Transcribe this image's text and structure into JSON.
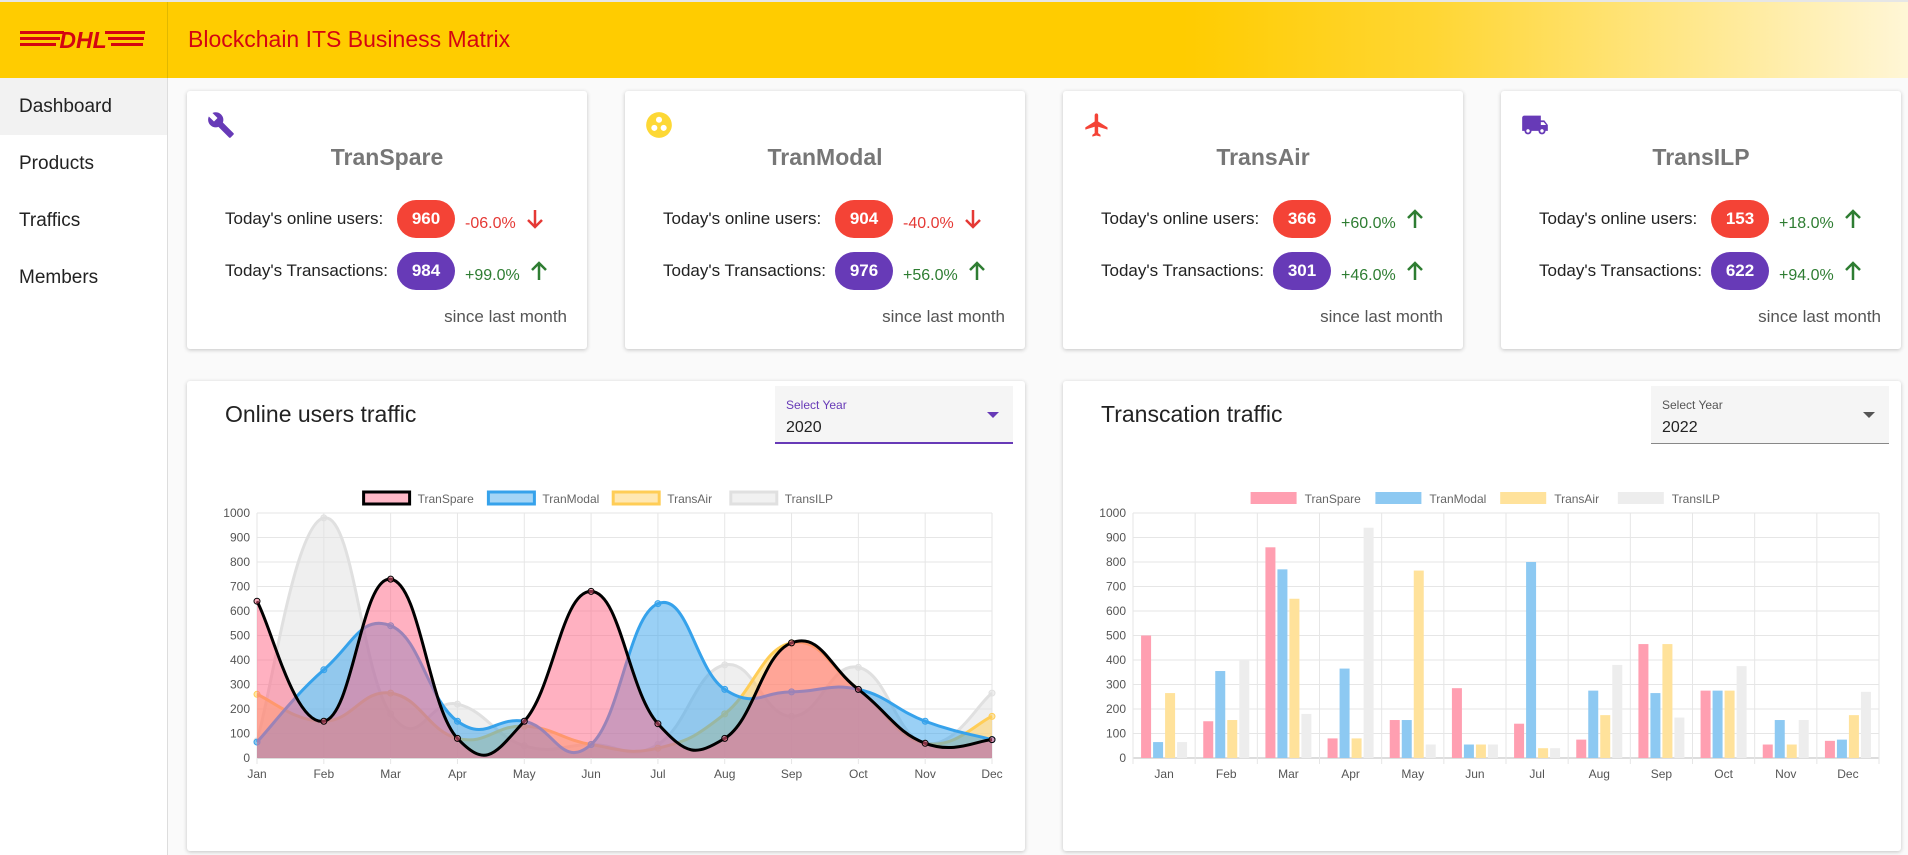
{
  "app": {
    "title": "Blockchain ITS Business Matrix",
    "logo_text": "DHL",
    "brand_red": "#d40511",
    "brand_yellow": "#ffcc00"
  },
  "sidebar": {
    "items": [
      {
        "label": "Dashboard",
        "active": true
      },
      {
        "label": "Products",
        "active": false
      },
      {
        "label": "Traffics",
        "active": false
      },
      {
        "label": "Members",
        "active": false
      }
    ]
  },
  "cards": [
    {
      "title": "TranSpare",
      "icon": "wrench-icon",
      "icon_color": "#673ab7",
      "users_label": "Today's online users:",
      "users": "960",
      "users_change": "-06.0%",
      "users_trend": "down",
      "tx_label": "Today's Transactions:",
      "tx": "984",
      "tx_change": "+99.0%",
      "tx_trend": "up",
      "since": "since last month"
    },
    {
      "title": "TranModal",
      "icon": "modal-icon",
      "icon_color": "#fdd835",
      "users_label": "Today's online users:",
      "users": "904",
      "users_change": "-40.0%",
      "users_trend": "down",
      "tx_label": "Today's Transactions:",
      "tx": "976",
      "tx_change": "+56.0%",
      "tx_trend": "up",
      "since": "since last month"
    },
    {
      "title": "TransAir",
      "icon": "airplane-icon",
      "icon_color": "#f44336",
      "users_label": "Today's online users:",
      "users": "366",
      "users_change": "+60.0%",
      "users_trend": "up",
      "tx_label": "Today's Transactions:",
      "tx": "301",
      "tx_change": "+46.0%",
      "tx_trend": "up",
      "since": "since last month"
    },
    {
      "title": "TransILP",
      "icon": "truck-icon",
      "icon_color": "#673ab7",
      "users_label": "Today's online users:",
      "users": "153",
      "users_change": "+18.0%",
      "users_trend": "up",
      "tx_label": "Today's Transactions:",
      "tx": "622",
      "tx_change": "+94.0%",
      "tx_trend": "up",
      "since": "since last month"
    }
  ],
  "panels": {
    "users": {
      "title": "Online users traffic",
      "select_label": "Select Year",
      "select_value": "2020"
    },
    "tx": {
      "title": "Transcation traffic",
      "select_label": "Select Year",
      "select_value": "2022"
    }
  },
  "chart_data": [
    {
      "type": "area",
      "categories": [
        "Jan",
        "Feb",
        "Mar",
        "Apr",
        "May",
        "Jun",
        "Jul",
        "Aug",
        "Sep",
        "Oct",
        "Nov",
        "Dec"
      ],
      "ylim": [
        0,
        1000
      ],
      "yticks": [
        "0",
        "100",
        "200",
        "300",
        "400",
        "500",
        "600",
        "700",
        "800",
        "900",
        "1000"
      ],
      "legend_position": "top",
      "series": [
        {
          "name": "TranSpare",
          "color": "#ff6384",
          "border": "#000000",
          "values": [
            640,
            150,
            730,
            80,
            150,
            680,
            140,
            80,
            470,
            280,
            60,
            75
          ]
        },
        {
          "name": "TranModal",
          "color": "#36a2eb",
          "border": "#36a2eb",
          "values": [
            65,
            360,
            540,
            150,
            150,
            55,
            630,
            280,
            270,
            280,
            150,
            75
          ]
        },
        {
          "name": "TransAir",
          "color": "#ffcd56",
          "border": "#ffcd56",
          "values": [
            260,
            150,
            265,
            80,
            130,
            55,
            40,
            180,
            470,
            280,
            60,
            170
          ]
        },
        {
          "name": "TransILP",
          "color": "#e0e0e0",
          "border": "#e0e0e0",
          "values": [
            70,
            980,
            180,
            220,
            50,
            55,
            55,
            380,
            170,
            370,
            60,
            265
          ]
        }
      ]
    },
    {
      "type": "bar",
      "categories": [
        "Jan",
        "Feb",
        "Mar",
        "Apr",
        "May",
        "Jun",
        "Jul",
        "Aug",
        "Sep",
        "Oct",
        "Nov",
        "Dec"
      ],
      "ylim": [
        0,
        1000
      ],
      "yticks": [
        "0",
        "100",
        "200",
        "300",
        "400",
        "500",
        "600",
        "700",
        "800",
        "900",
        "1000"
      ],
      "legend_position": "top",
      "series": [
        {
          "name": "TranSpare",
          "color": "#ff9fb1",
          "values": [
            500,
            150,
            860,
            80,
            155,
            285,
            140,
            75,
            465,
            275,
            55,
            70
          ]
        },
        {
          "name": "TranModal",
          "color": "#8dc9f2",
          "values": [
            65,
            355,
            770,
            365,
            155,
            55,
            800,
            275,
            265,
            275,
            155,
            75
          ]
        },
        {
          "name": "TransAir",
          "color": "#ffe29b",
          "values": [
            265,
            155,
            650,
            80,
            765,
            55,
            40,
            175,
            465,
            275,
            55,
            175
          ]
        },
        {
          "name": "TransILP",
          "color": "#ededed",
          "values": [
            65,
            400,
            180,
            940,
            55,
            55,
            40,
            380,
            165,
            375,
            155,
            270
          ]
        }
      ]
    }
  ]
}
